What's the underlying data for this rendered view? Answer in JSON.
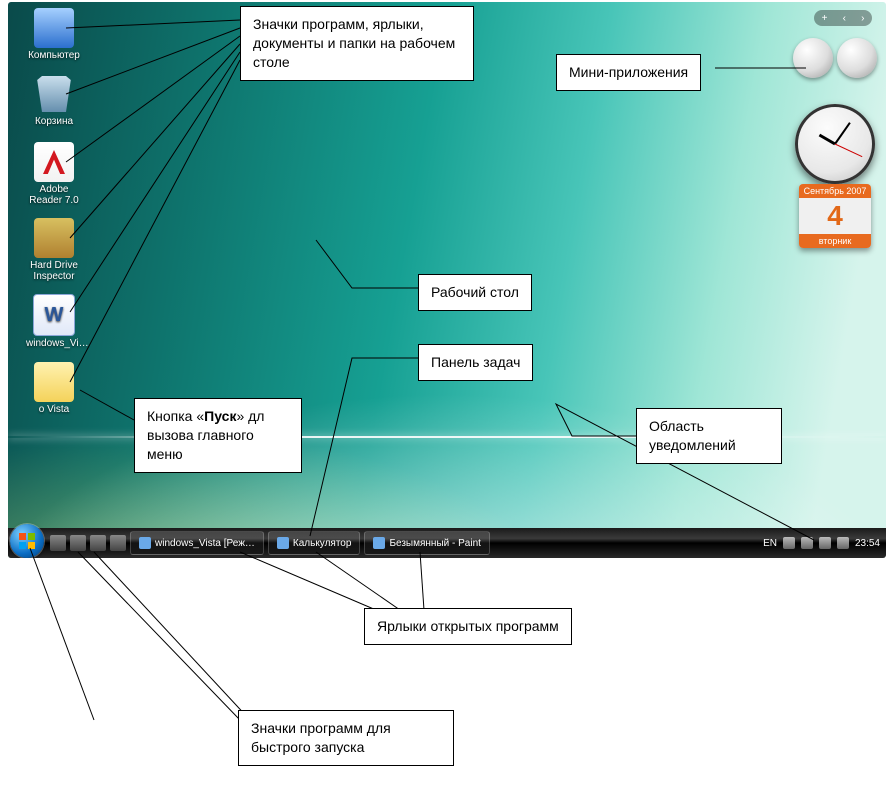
{
  "desktop_icons": [
    {
      "label": "Компьютер",
      "css": "ic-comp"
    },
    {
      "label": "Корзина",
      "css": "ic-bin"
    },
    {
      "label": "Adobe Reader 7.0",
      "css": "ic-adobe"
    },
    {
      "label": "Hard Drive Inspector",
      "css": "ic-hd"
    },
    {
      "label": "windows_Vi…",
      "css": "ic-doc"
    },
    {
      "label": "о Vista",
      "css": "ic-folder"
    }
  ],
  "calendar": {
    "month_year": "Сентябрь 2007",
    "day": "4",
    "weekday": "вторник"
  },
  "taskbar": {
    "buttons": [
      {
        "label": "windows_Vista [Реж…"
      },
      {
        "label": "Калькулятор"
      },
      {
        "label": "Безымянный - Paint"
      }
    ],
    "lang": "EN",
    "time": "23:54"
  },
  "callouts": {
    "icons": "Значки программ, ярлыки, документы и папки на рабочем столе",
    "gadgets": "Мини-приложения",
    "desktop": "Рабочий стол",
    "taskbar": "Панель задач",
    "start_pre": "Кнопка «",
    "start_b": "Пуск",
    "start_post": "» дл вызова главного меню",
    "notif": "Область уведомлений",
    "openapps": "Ярлыки открытых программ",
    "quick": "Значки программ для быстрого запуска"
  }
}
